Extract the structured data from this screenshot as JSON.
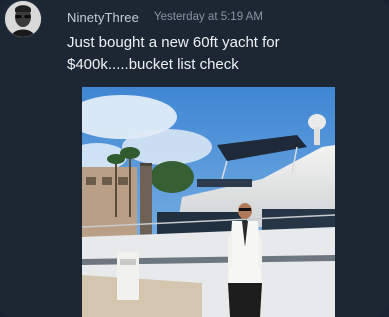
{
  "post": {
    "username": "NinetyThree",
    "timestamp": "Yesterday at 5:19 AM",
    "message": "Just bought a new 60ft yacht for $400k.....bucket list check"
  },
  "avatar": {
    "icon": "sunglasses-portrait-avatar"
  },
  "attachment": {
    "type": "photo",
    "subject": "man in white suit standing in front of yacht at dock"
  }
}
